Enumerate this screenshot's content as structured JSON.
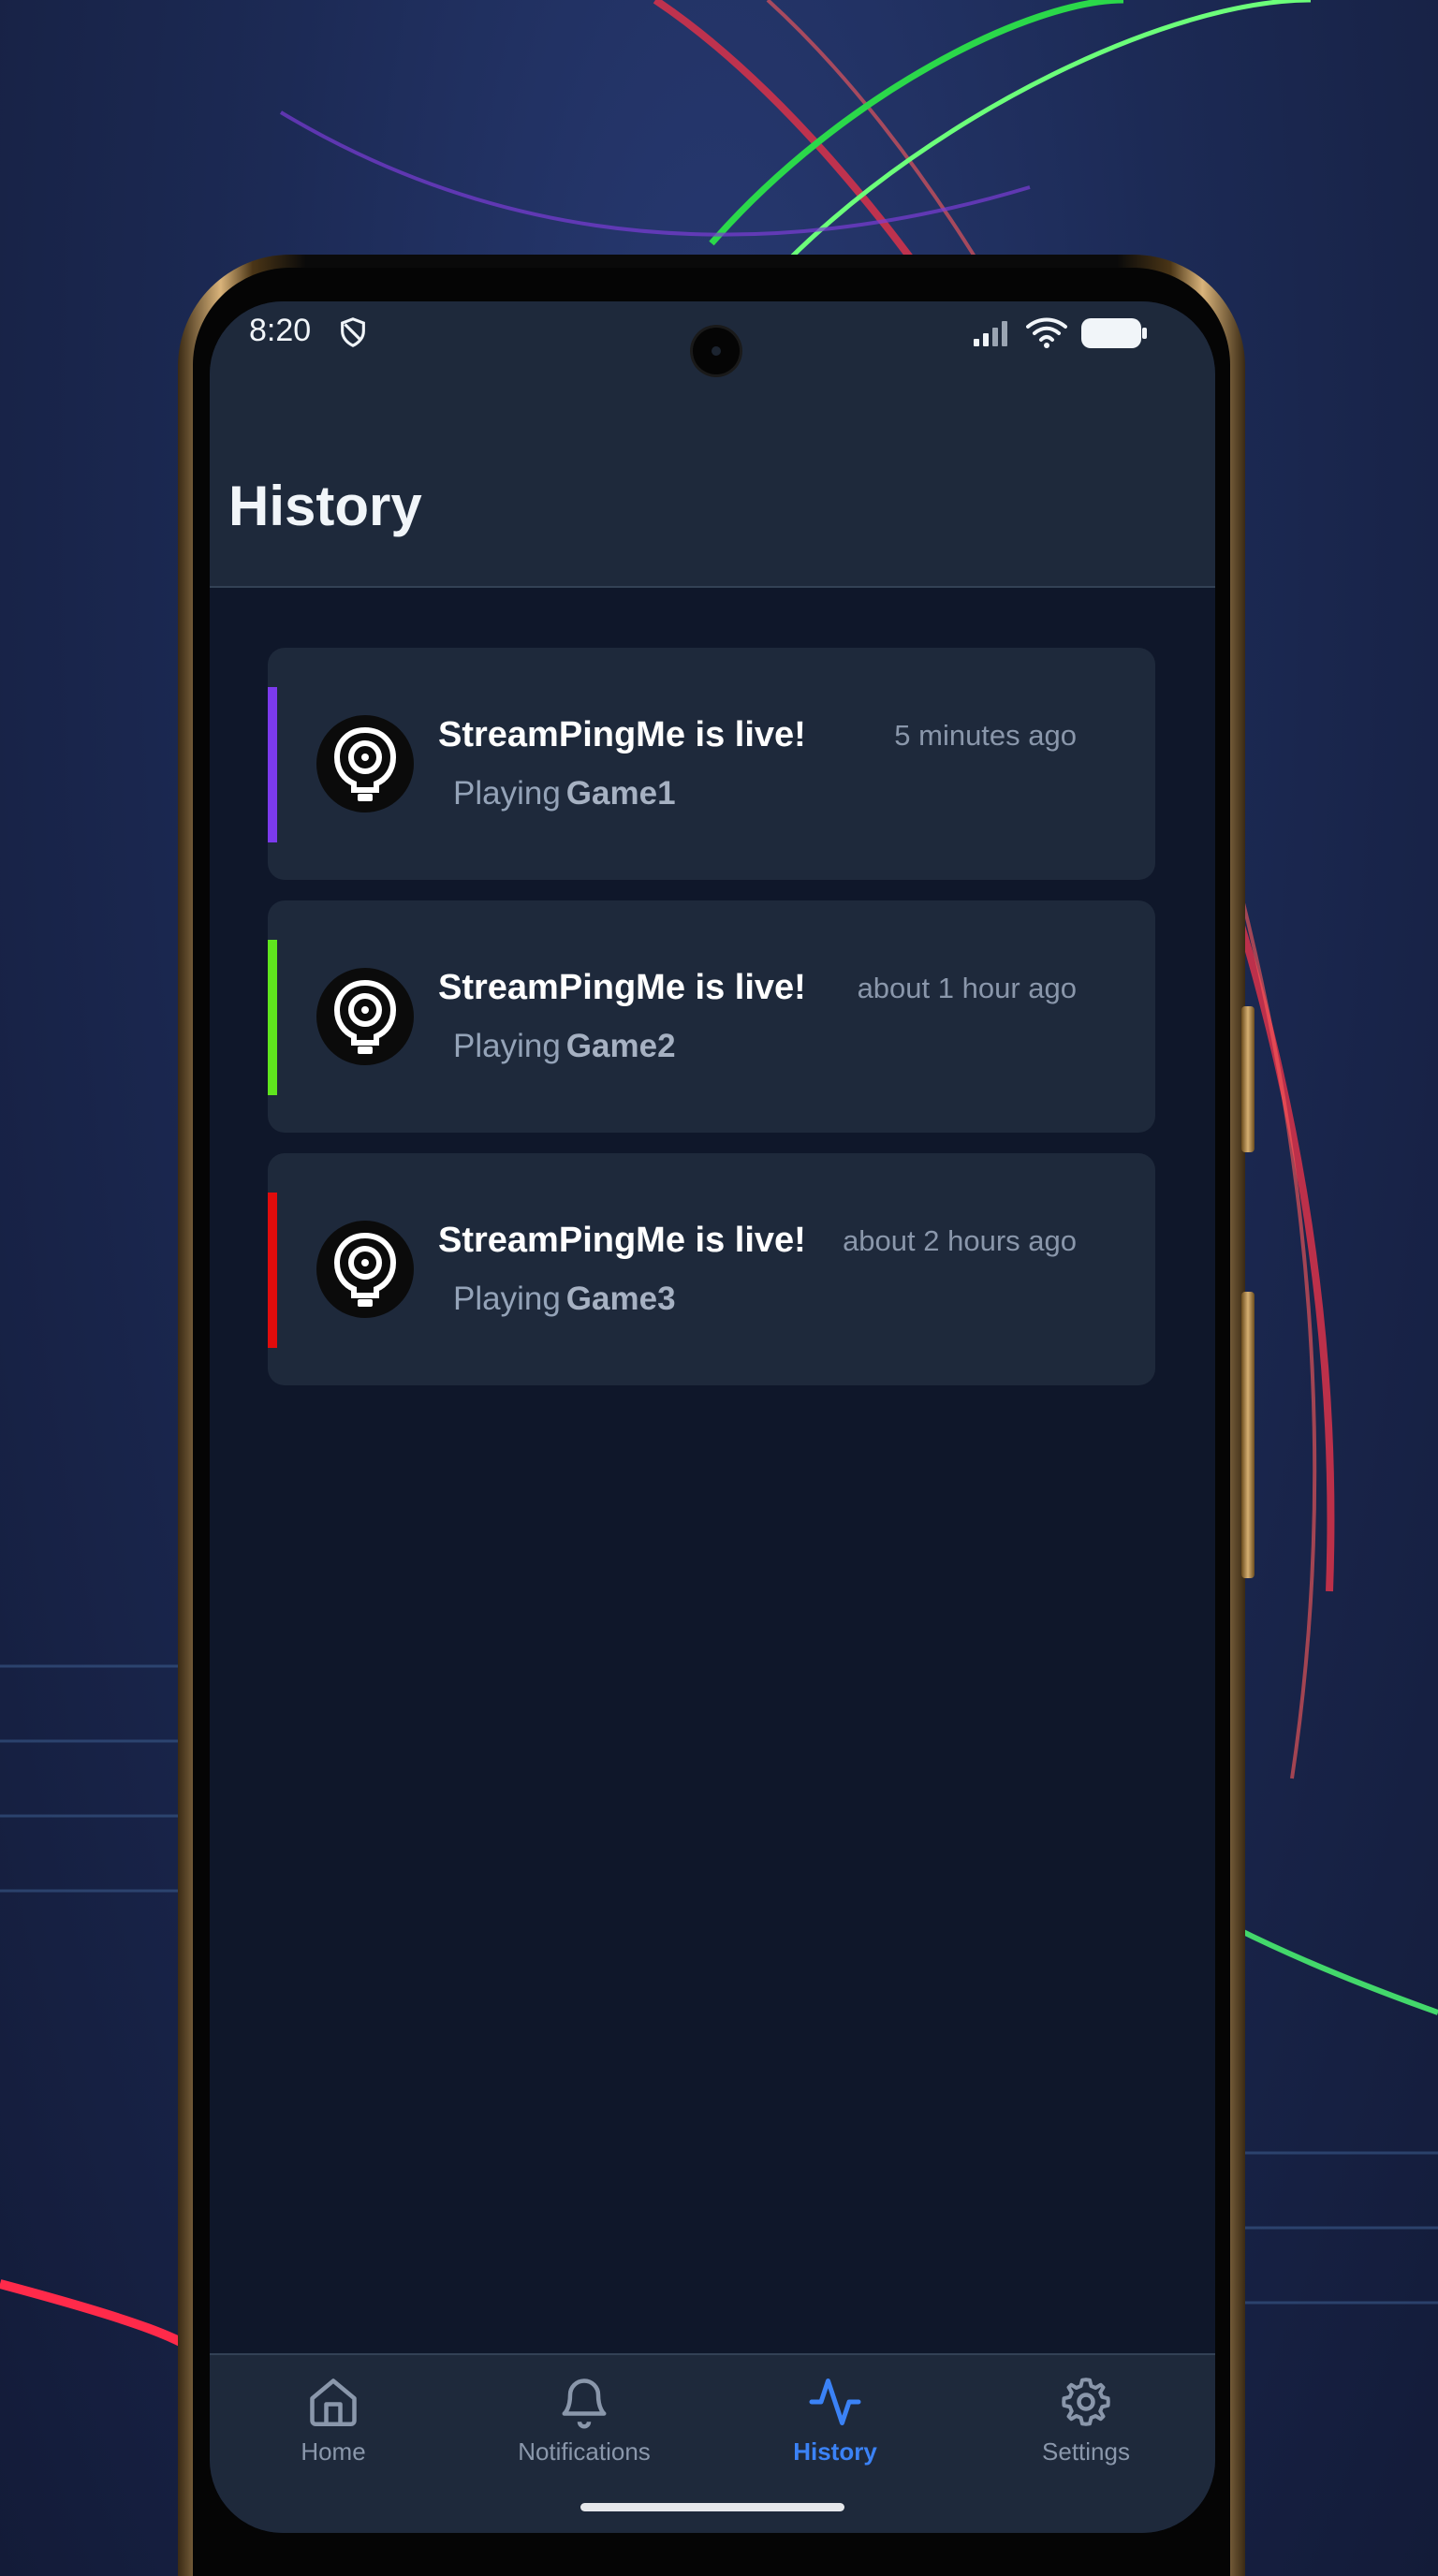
{
  "status_bar": {
    "time": "8:20",
    "icons": [
      "shield-icon",
      "signal-icon",
      "wifi-icon",
      "battery-icon"
    ]
  },
  "header": {
    "title": "History"
  },
  "history": [
    {
      "title": "StreamPingMe is live!",
      "time": "5 minutes ago",
      "playing": "Playing",
      "game": "Game1",
      "accent": "#7c3aed"
    },
    {
      "title": "StreamPingMe is live!",
      "time": "about 1 hour ago",
      "playing": "Playing",
      "game": "Game2",
      "accent": "#5fe51e"
    },
    {
      "title": "StreamPingMe is live!",
      "time": "about 2 hours ago",
      "playing": "Playing",
      "game": "Game3",
      "accent": "#e10c0c"
    }
  ],
  "nav": {
    "items": [
      {
        "label": "Home",
        "icon": "home-icon"
      },
      {
        "label": "Notifications",
        "icon": "bell-icon"
      },
      {
        "label": "History",
        "icon": "activity-icon",
        "active": true
      },
      {
        "label": "Settings",
        "icon": "gear-icon"
      }
    ]
  },
  "colors": {
    "accent": "#3b82f6",
    "background": "#0f172a",
    "surface": "#1e293b"
  }
}
